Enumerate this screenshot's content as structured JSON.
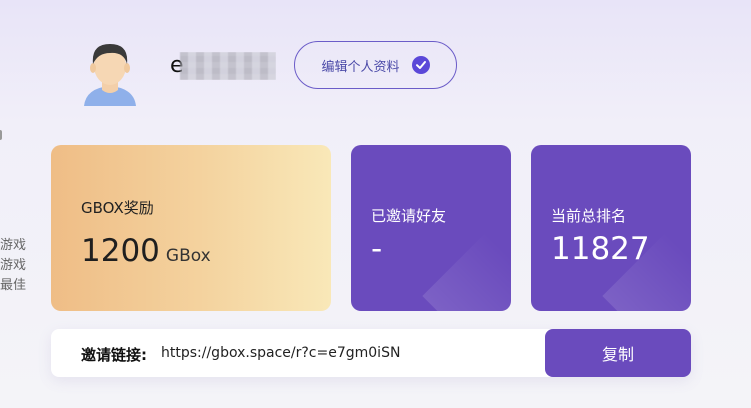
{
  "profile": {
    "username_visible": "e",
    "edit_label": "编辑个人资料"
  },
  "side": {
    "lines": [
      "游戏",
      "游戏",
      "最佳"
    ]
  },
  "reward": {
    "label": "GBOX奖励",
    "value": "1200",
    "unit": "GBox"
  },
  "invited": {
    "label": "已邀请好友",
    "value": "-"
  },
  "rank": {
    "label": "当前总排名",
    "value": "11827"
  },
  "invite_link": {
    "label": "邀请链接:",
    "url": "https://gbox.space/r?c=e7gm0iSN",
    "copy_label": "复制"
  },
  "colors": {
    "accent": "#6a4bbd",
    "reward_gradient_start": "#efbd86",
    "reward_gradient_end": "#f9e8b8"
  }
}
